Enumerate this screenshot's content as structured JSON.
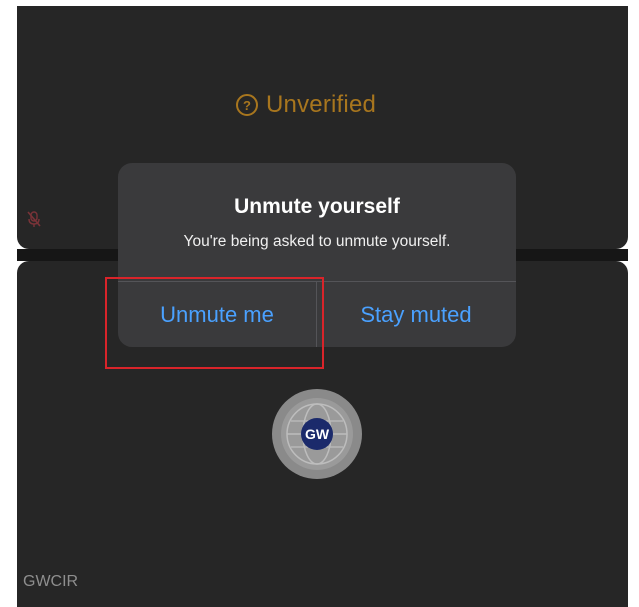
{
  "top_tile": {
    "status_text": "Unverified",
    "status_icon": "question-circle-icon",
    "mic_icon": "muted-mic-icon",
    "status_color": "#a8761e"
  },
  "bottom_tile": {
    "participant_name": "GWCIR",
    "avatar_text": "GW",
    "avatar_icon": "globe-logo-icon"
  },
  "dialog": {
    "title": "Unmute yourself",
    "message": "You're being asked to unmute yourself.",
    "primary_label": "Unmute me",
    "secondary_label": "Stay muted",
    "button_color": "#4aa1ff"
  },
  "annotation": {
    "highlight_color": "#d9242a"
  }
}
